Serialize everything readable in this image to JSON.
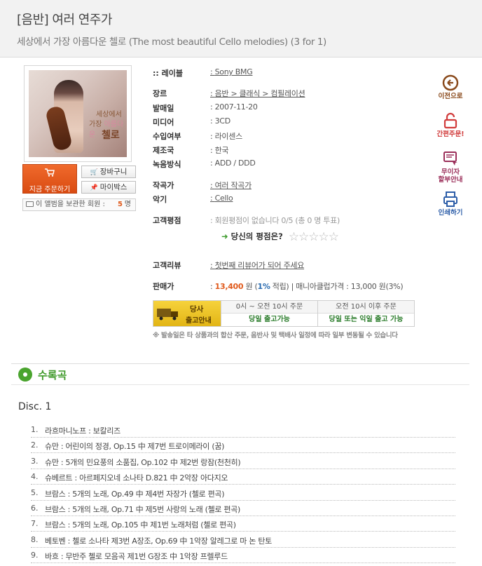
{
  "header": {
    "title": "[음반] 여러 연주가",
    "subtitle": "세상에서 가장 아름다운 첼로 (The most beautiful Cello melodies) (3 for 1)"
  },
  "cover": {
    "line1": "세상에서",
    "line2a": "가장 ",
    "line2b": "아름다운",
    "line3": "첼로"
  },
  "actions": {
    "order_label": "지금 주문하기",
    "cart_label": "장바구니",
    "mybox_label": "마이박스",
    "saved_label": "이 앨범을 보관한 회원 :",
    "saved_count": "5",
    "saved_unit": "명"
  },
  "info": {
    "label_key": ":: 레이블",
    "label_val": "Sony BMG",
    "genre_key": "장르",
    "genre_val": "음반 > 클래식 > 컴필레이션",
    "release_key": "발매일",
    "release_val": "2007-11-20",
    "media_key": "미디어",
    "media_val": "3CD",
    "import_key": "수입여부",
    "import_val": "라이센스",
    "country_key": "제조국",
    "country_val": "한국",
    "rec_key": "녹음방식",
    "rec_val": "ADD / DDD",
    "composer_key": "작곡가",
    "composer_val": "여러 작곡가",
    "instrument_key": "악기",
    "instrument_val": "Cello",
    "rating_key": "고객평점",
    "rating_val": "회원평점이 없습니다 0/5 (총 0 명 투표)",
    "your_rating": "당신의 평점은?",
    "review_key": "고객리뷰",
    "review_val": "첫번째 리뷰어가 되어 주세요",
    "price_key": "판매가",
    "price_amount": "13,400",
    "price_unit": "원",
    "price_point_open": "(",
    "price_point": "1%",
    "price_point_close": "적립)",
    "price_sep": "|",
    "manufacturer_price": "매니아클럽가격 : 13,000 원(3%)"
  },
  "shipping": {
    "badge1": "당사",
    "badge2": "출고안내",
    "col1_head": "0시 ~ 오전 10시 주문",
    "col1_val": "당일 출고가능",
    "col2_head": "오전 10시 이후 주문",
    "col2_val": "당일 또는 익일 출고 가능",
    "note": "※ 발송일은 타 상품과의 합산 주문, 음반사 및 택배사 일정에 따라 일부 변동될 수 있습니다"
  },
  "side": {
    "prev": "이전으로",
    "quick": "간편주문!",
    "inst1": "무이자",
    "inst2": "할부안내",
    "print": "인쇄하기"
  },
  "tracks_section": {
    "title": "수록곡",
    "disc": "Disc. 1",
    "tracks": [
      {
        "no": "1.",
        "name": "라흐마니노프 : 보칼리즈"
      },
      {
        "no": "2.",
        "name": "슈만 : 어린이의 정경, Op.15 中 제7번 트로이메라이 (꿈)"
      },
      {
        "no": "3.",
        "name": "슈만 : 5개의 민요풍의 소품집, Op.102 中 제2번 랑잠(천천히)"
      },
      {
        "no": "4.",
        "name": "슈베르트 : 아르페지오네 소나타 D.821 中 2악장 아다지오"
      },
      {
        "no": "5.",
        "name": "브람스 : 5개의 노래, Op.49 中 제4번 자장가 (첼로 편곡)"
      },
      {
        "no": "6.",
        "name": "브람스 : 5개의 노래, Op.71 中 제5번 사랑의 노래 (첼로 편곡)"
      },
      {
        "no": "7.",
        "name": "브람스 : 5개의 노래, Op.105 中 제1번 노래처럼 (첼로 편곡)"
      },
      {
        "no": "8.",
        "name": "베토벤 : 첼로 소나타 제3번 A장조, Op.69 中 1악장 알레그로 마 논 탄토"
      },
      {
        "no": "9.",
        "name": "바흐 : 무반주 첼로 모음곡 제1번 G장조 中 1악장 프렐루드"
      }
    ]
  }
}
